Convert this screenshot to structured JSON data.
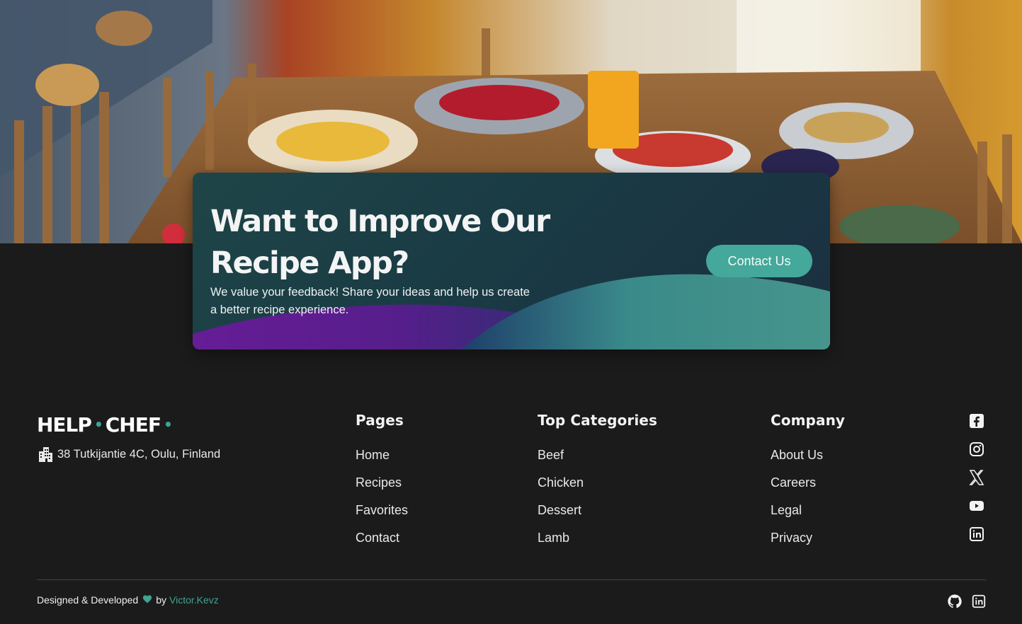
{
  "hero": {
    "image": "dining-table-food-photo"
  },
  "cta": {
    "title": "Want to Improve Our Recipe App?",
    "description": "We value your feedback! Share your ideas and help us create a better recipe experience.",
    "button_label": "Contact Us"
  },
  "brand": {
    "part1": "HELP",
    "part2": "CHEF",
    "dot": "•",
    "accent_color": "#3fa392"
  },
  "address": {
    "icon": "building-icon",
    "text": "38 Tutkijantie 4C, Oulu, Finland"
  },
  "footer": {
    "pages": {
      "heading": "Pages",
      "items": [
        "Home",
        "Recipes",
        "Favorites",
        "Contact"
      ]
    },
    "categories": {
      "heading": "Top Categories",
      "items": [
        "Beef",
        "Chicken",
        "Dessert",
        "Lamb"
      ]
    },
    "company": {
      "heading": "Company",
      "items": [
        "About Us",
        "Careers",
        "Legal",
        "Privacy"
      ]
    },
    "social": [
      "facebook-icon",
      "instagram-icon",
      "x-icon",
      "youtube-icon",
      "linkedin-icon"
    ]
  },
  "credits": {
    "text": "Designed & Developed",
    "by": "by",
    "author": "Victor.Kevz",
    "heart_color": "#3fa392",
    "icons": [
      "github-icon",
      "linkedin-icon"
    ]
  },
  "colors": {
    "background": "#1b1b1b",
    "accent": "#44a89a",
    "card": "#1e4548"
  }
}
